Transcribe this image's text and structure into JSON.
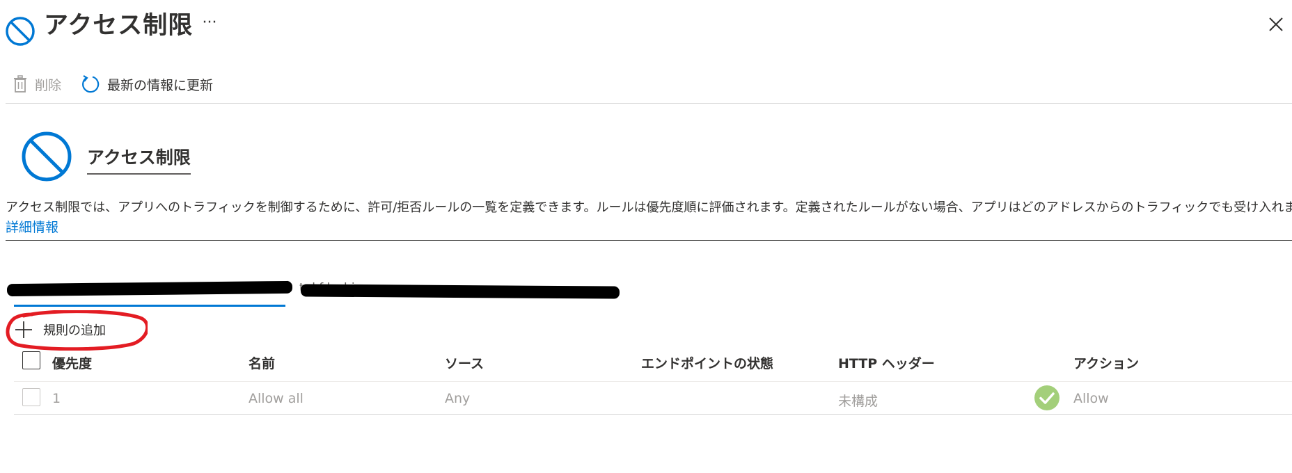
{
  "header": {
    "title": "アクセス制限",
    "more_label": "···"
  },
  "toolbar": {
    "delete_label": "削除",
    "refresh_label": "最新の情報に更新"
  },
  "hero": {
    "title": "アクセス制限",
    "description": "アクセス制限では、アプリへのトラフィックを制御するために、許可/拒否ルールの一覧を定義できます。ルールは優先度順に評価されます。定義されたルールがない場合、アプリはどのアドレスからのトラフィックでも受け入れます。",
    "learn_more": "詳細情報"
  },
  "tabs": {
    "partial_text": "t  d f  l  s  bi"
  },
  "add_rule": {
    "label": "規則の追加"
  },
  "table": {
    "columns": [
      "優先度",
      "名前",
      "ソース",
      "エンドポイントの状態",
      "HTTP ヘッダー",
      "アクション"
    ],
    "rows": [
      {
        "priority": "1",
        "name": "Allow all",
        "source": "Any",
        "endpoint_state": "",
        "http_header": "未構成",
        "action": "Allow",
        "status_icon": "check-circle-icon"
      }
    ]
  },
  "colors": {
    "accent": "#0078d4",
    "annotation": "#e31c23",
    "success": "#a3cf7a"
  }
}
